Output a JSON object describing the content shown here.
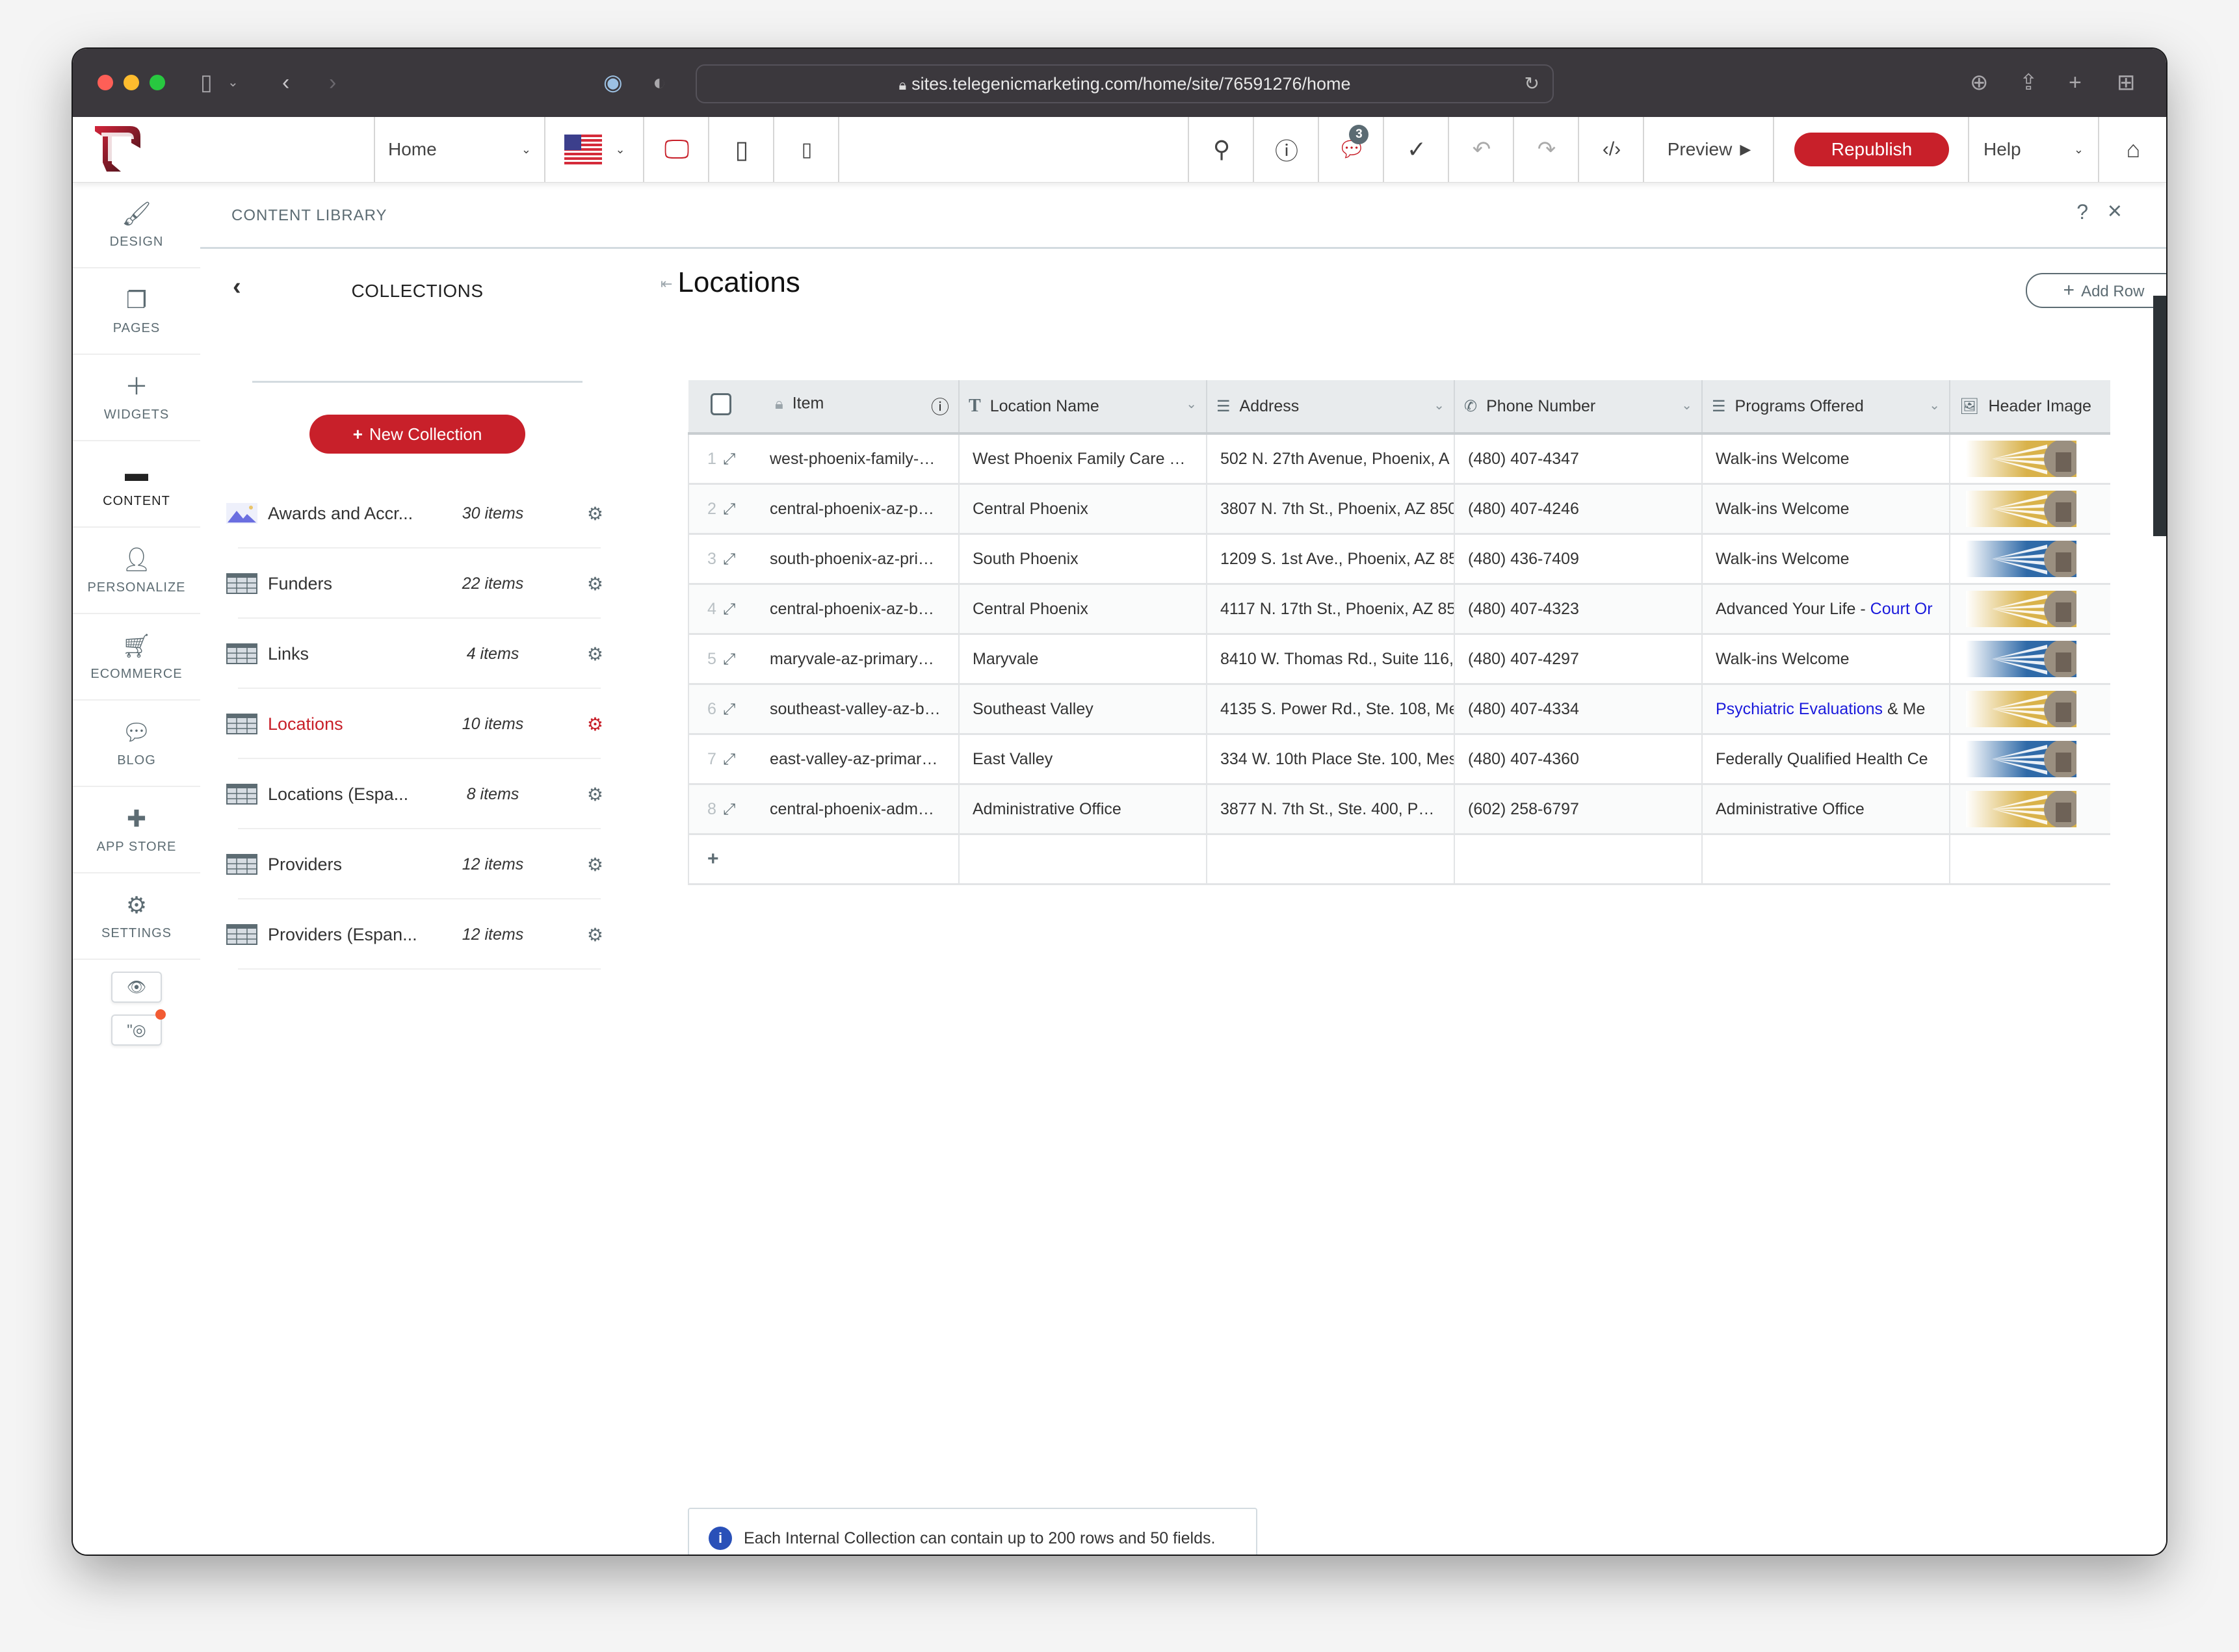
{
  "browser": {
    "url": "sites.telegenicmarketing.com/home/site/76591276/home",
    "icons": [
      "sidebar-icon",
      "chevron-down-icon",
      "back-icon",
      "forward-icon",
      "password-icon",
      "shield-icon",
      "download-icon",
      "share-icon",
      "new-tab-icon",
      "tab-overview-icon"
    ]
  },
  "toolbar": {
    "page_select": "Home",
    "language": "US flag",
    "comments_badge": "3",
    "preview_label": "Preview",
    "republish_label": "Republish",
    "help_label": "Help"
  },
  "leftnav": {
    "items": [
      {
        "label": "DESIGN",
        "icon": "brush-icon"
      },
      {
        "label": "PAGES",
        "icon": "pages-icon"
      },
      {
        "label": "WIDGETS",
        "icon": "plus-icon"
      },
      {
        "label": "CONTENT",
        "icon": "folder-icon",
        "active": true
      },
      {
        "label": "PERSONALIZE",
        "icon": "person-icon"
      },
      {
        "label": "ECOMMERCE",
        "icon": "cart-icon"
      },
      {
        "label": "BLOG",
        "icon": "chat-bubble-icon"
      },
      {
        "label": "APP STORE",
        "icon": "puzzle-icon"
      },
      {
        "label": "SETTINGS",
        "icon": "gear-icon"
      }
    ]
  },
  "content_library": {
    "title": "CONTENT LIBRARY",
    "help": "?",
    "close": "×"
  },
  "collections": {
    "title": "COLLECTIONS",
    "new_button": "New Collection",
    "items": [
      {
        "name": "Awards and Accr...",
        "count": "30 items",
        "icon": "image-collection-icon"
      },
      {
        "name": "Funders",
        "count": "22 items",
        "icon": "table-icon"
      },
      {
        "name": "Links",
        "count": "4 items",
        "icon": "table-icon"
      },
      {
        "name": "Locations",
        "count": "10 items",
        "icon": "table-icon",
        "active": true
      },
      {
        "name": "Locations (Espa...",
        "count": "8 items",
        "icon": "table-icon"
      },
      {
        "name": "Providers",
        "count": "12 items",
        "icon": "table-icon"
      },
      {
        "name": "Providers (Espan...",
        "count": "12 items",
        "icon": "table-icon"
      }
    ]
  },
  "main": {
    "title": "Locations",
    "add_row": "Add Row",
    "help": "?",
    "columns": [
      "Item",
      "Location Name",
      "Address",
      "Phone Number",
      "Programs Offered",
      "Header Image"
    ],
    "rows": [
      {
        "n": "1",
        "item": "west-phoenix-family-…",
        "name": "West Phoenix Family Care …",
        "address": "502 N. 27th Avenue, Phoenix, A",
        "phone": "(480) 407-4347",
        "programs": "Walk-ins Welcome",
        "programs_link": "",
        "programs_rest": "",
        "img": "gold"
      },
      {
        "n": "2",
        "item": "central-phoenix-az-p…",
        "name": "Central Phoenix",
        "address": "3807 N. 7th St., Phoenix, AZ 850",
        "phone": "(480) 407-4246",
        "programs": "Walk-ins Welcome",
        "programs_link": "",
        "programs_rest": "",
        "img": "gold"
      },
      {
        "n": "3",
        "item": "south-phoenix-az-pri…",
        "name": "South Phoenix",
        "address": "1209 S. 1st Ave., Phoenix, AZ 85",
        "phone": "(480) 436-7409",
        "programs": "Walk-ins Welcome",
        "programs_link": "",
        "programs_rest": "",
        "img": "blue"
      },
      {
        "n": "4",
        "item": "central-phoenix-az-b…",
        "name": "Central Phoenix",
        "address": "4117 N. 17th St., Phoenix, AZ 85",
        "phone": "(480) 407-4323",
        "programs": "Advanced Your Life - ",
        "programs_link": "Court Or",
        "programs_rest": "",
        "img": "gold"
      },
      {
        "n": "5",
        "item": "maryvale-az-primary…",
        "name": "Maryvale",
        "address": "8410 W. Thomas Rd., Suite 116,",
        "phone": "(480) 407-4297",
        "programs": "Walk-ins Welcome",
        "programs_link": "",
        "programs_rest": "",
        "img": "blue"
      },
      {
        "n": "6",
        "item": "southeast-valley-az-b…",
        "name": "Southeast Valley",
        "address": "4135 S. Power Rd., Ste. 108, Me",
        "phone": "(480) 407-4334",
        "programs": "",
        "programs_link": "Psychiatric Evaluations",
        "programs_rest": " & Me",
        "img": "gold"
      },
      {
        "n": "7",
        "item": "east-valley-az-primar…",
        "name": "East Valley",
        "address": "334 W. 10th Place Ste. 100, Mes",
        "phone": "(480) 407-4360",
        "programs": "Federally Qualified Health Ce",
        "programs_link": "",
        "programs_rest": "",
        "img": "blue"
      },
      {
        "n": "8",
        "item": "central-phoenix-adm…",
        "name": "Administrative Office",
        "address": "3877 N. 7th St., Ste. 400, P…",
        "phone": "(602) 258-6797",
        "programs": "Administrative Office",
        "programs_link": "",
        "programs_rest": "",
        "img": "gold"
      }
    ],
    "add_row_plus": "+",
    "notice": "Each Internal Collection can contain up to 200 rows and 50 fields."
  },
  "colors": {
    "brand_red": "#c8202a",
    "link_blue": "#1a1adc",
    "info_blue": "#2950b8",
    "icon_gray": "#5d6c73"
  }
}
